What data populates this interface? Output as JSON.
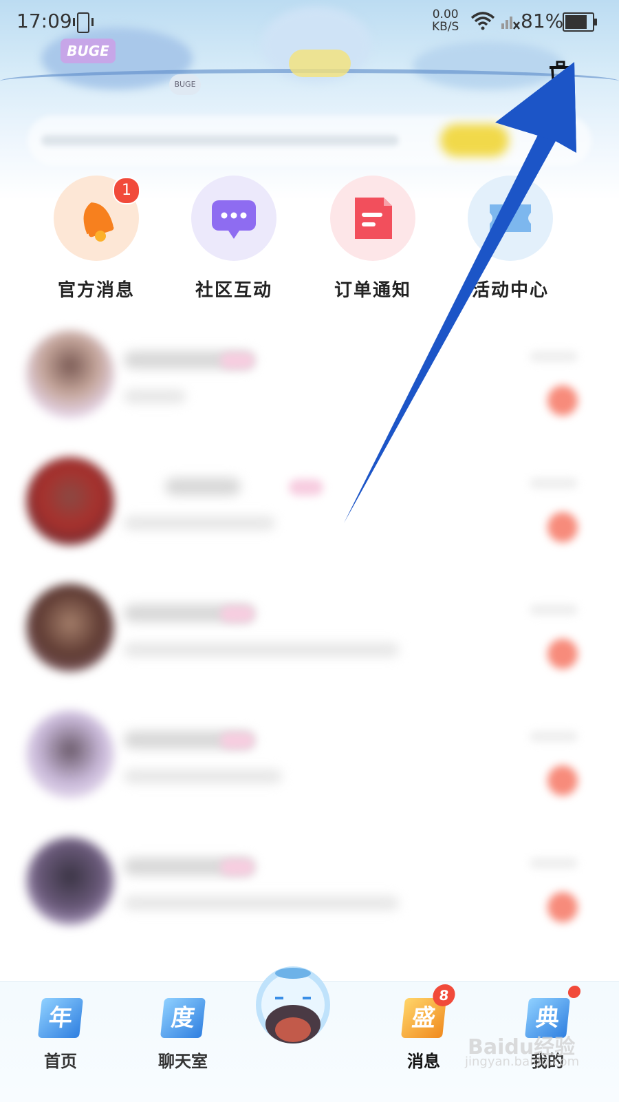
{
  "status_bar": {
    "time": "17:09",
    "net_speed_value": "0.00",
    "net_speed_unit": "KB/S",
    "battery_percent": "81%",
    "battery_level": 0.81
  },
  "header": {
    "banner_text_1": "BUGE",
    "banner_text_2": "BUGE"
  },
  "categories": [
    {
      "label": "官方消息",
      "icon": "bell-icon",
      "color": "#fde7d6",
      "badge": "1"
    },
    {
      "label": "社区互动",
      "icon": "chat-bubble-icon",
      "color": "#ece9fb"
    },
    {
      "label": "订单通知",
      "icon": "document-icon",
      "color": "#fde6e8"
    },
    {
      "label": "活动中心",
      "icon": "ticket-icon",
      "color": "#e3f0fb"
    }
  ],
  "conversations_count_visible": 5,
  "tabbar": {
    "tabs": [
      {
        "label": "首页",
        "icon_char": "年",
        "icon": "home-tab-icon"
      },
      {
        "label": "聊天室",
        "icon_char": "度",
        "icon": "chatroom-tab-icon"
      },
      {
        "label": "",
        "icon": "center-mascot-icon"
      },
      {
        "label": "消息",
        "icon_char": "盛",
        "icon": "messages-tab-icon",
        "badge": "8",
        "active": true
      },
      {
        "label": "我的",
        "icon_char": "典",
        "icon": "profile-tab-icon",
        "dot": true
      }
    ]
  },
  "watermark": {
    "text": "Baidu经验",
    "url": "jingyan.baidu.com"
  },
  "colors": {
    "badge_red": "#f14a3a",
    "arrow_blue": "#1c55c7",
    "tab_icon_blue": "#3a8ee6",
    "tab_icon_orange": "#f39a2b"
  }
}
